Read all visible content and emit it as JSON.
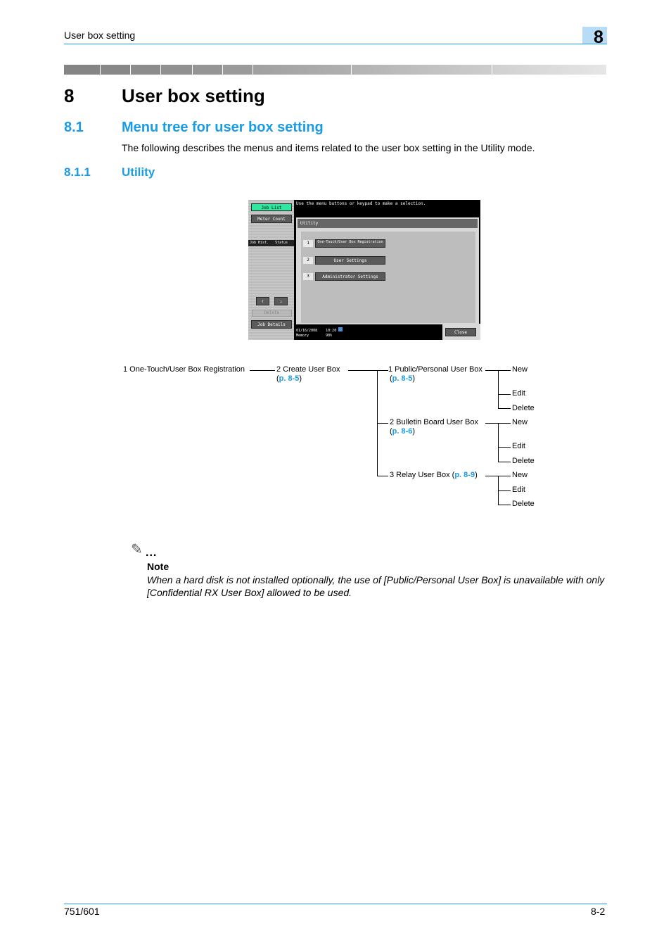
{
  "header": {
    "running_title": "User box setting",
    "chapter_number": "8"
  },
  "chapter": {
    "number": "8",
    "title": "User box setting"
  },
  "section": {
    "number": "8.1",
    "title": "Menu tree for user box setting",
    "intro": "The following describes the menus and items related to the user box setting in the Utility mode."
  },
  "subsection": {
    "number": "8.1.1",
    "title": "Utility"
  },
  "screenshot": {
    "job_list": "Job List",
    "meter_count": "Meter Count",
    "status_tab_left": "Job Hist.",
    "status_tab": "Status",
    "up_icon": "↑",
    "down_icon": "↓",
    "delete": "Delete",
    "job_details": "Job Details",
    "message": "Use the menu buttons or keypad to make a selection.",
    "panel_title": "Utility",
    "menu": [
      {
        "num": "1",
        "label": "One-Touch/User Box Registration"
      },
      {
        "num": "2",
        "label": "User Settings"
      },
      {
        "num": "3",
        "label": "Administrator Settings"
      }
    ],
    "date": "01/16/2008",
    "time": "10:20",
    "memory_label": "Memory",
    "memory_value": "98%",
    "close": "Close"
  },
  "tree": {
    "root": "1 One-Touch/User Box Registration",
    "level1": {
      "label": "2 Create User Box",
      "ref": "p. 8-5"
    },
    "level2": [
      {
        "label": "1 Public/Personal User Box",
        "ref": "p. 8-5",
        "children": [
          "New",
          "Edit",
          "Delete"
        ]
      },
      {
        "label": "2 Bulletin Board User Box",
        "ref": "p. 8-6",
        "children": [
          "New",
          "Edit",
          "Delete"
        ]
      },
      {
        "label": "3 Relay User Box",
        "ref": "p. 8-9",
        "children": [
          "New",
          "Edit",
          "Delete"
        ]
      }
    ]
  },
  "note": {
    "icon": "✎",
    "dots": "...",
    "title": "Note",
    "text": "When a hard disk is not installed optionally, the use of [Public/Personal User Box] is unavailable with only [Confidential RX User Box] allowed to be used."
  },
  "footer": {
    "model": "751/601",
    "page": "8-2"
  }
}
